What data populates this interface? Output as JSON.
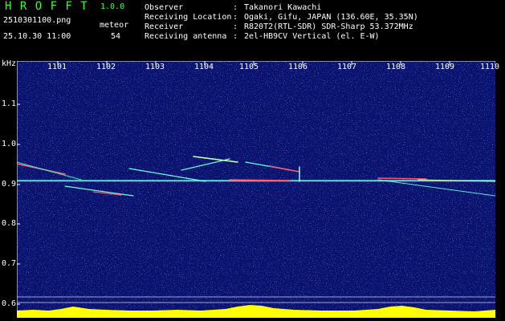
{
  "header": {
    "app_title": "H R O F F T",
    "version": "1.0.0",
    "file_name": "2510301100.png",
    "meteor_label": "meteor",
    "datetime": "25.10.30 11:00",
    "meteor_count": "54"
  },
  "info": [
    {
      "label": "Observer",
      "value": "Takanori Kawachi"
    },
    {
      "label": "Receiving Location",
      "value": "Ogaki, Gifu, JAPAN (136.60E, 35.35N)"
    },
    {
      "label": "Receiver",
      "value": "R820T2(RTL-SDR) SDR-Sharp 53.372MHz"
    },
    {
      "label": "Receiving antenna",
      "value": "2el-HB9CV Vertical (el. E-W)"
    }
  ],
  "y_axis": {
    "unit": "kHz",
    "ticks": [
      "1.1",
      "1.0",
      "0.9",
      "0.8",
      "0.7",
      "0.6"
    ]
  },
  "x_axis": {
    "ticks": [
      "1101",
      "1102",
      "1103",
      "1104",
      "1105",
      "1106",
      "1107",
      "1108",
      "1109",
      "1110"
    ]
  },
  "colors": {
    "background": "#000000",
    "plot_background": "#0a1270",
    "title_green": "#33ff33",
    "text_white": "#ffffff",
    "signal_yellow": "#ffff00",
    "carrier_cyan": "#66ffee",
    "echo_red": "#ff3344"
  }
}
